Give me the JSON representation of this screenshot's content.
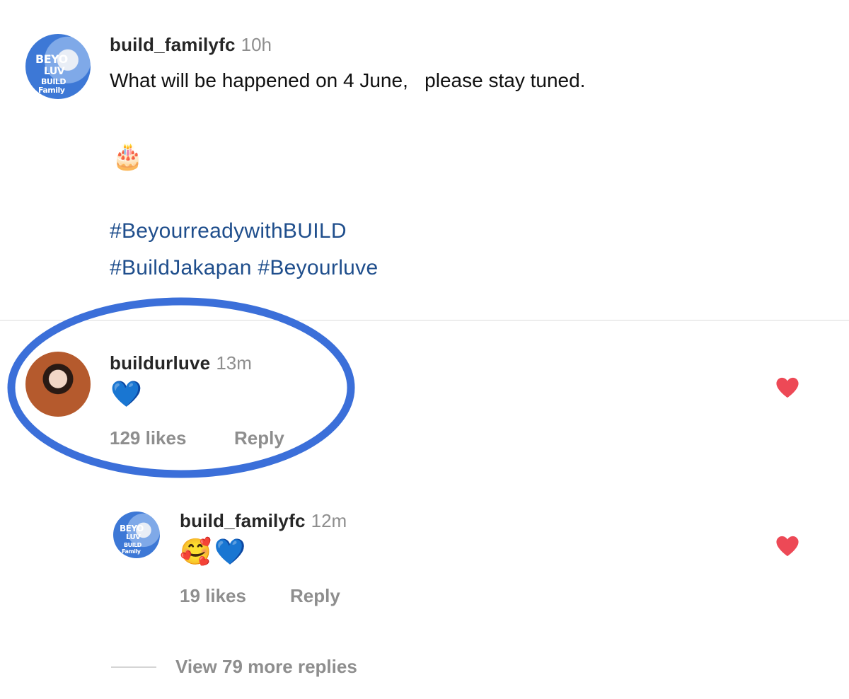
{
  "post": {
    "username": "build_familyfc",
    "time": "10h",
    "text": "What will be happened on 4 June,   please stay tuned.",
    "emoji": "🎂",
    "hashtags_line1": "#BeyourreadywithBUILD",
    "hashtags_line2": "#BuildJakapan #Beyourluve"
  },
  "comment": {
    "username": "buildurluve",
    "time": "13m",
    "text": "💙",
    "likes": "129 likes",
    "reply_label": "Reply",
    "highlight_color": "#3b6fd9"
  },
  "reply": {
    "username": "build_familyfc",
    "time": "12m",
    "text": "🥰💙",
    "likes": "19 likes",
    "reply_label": "Reply"
  },
  "view_more": "View 79 more replies",
  "colors": {
    "heart": "#ed4956",
    "hashtag": "#1f4e8c",
    "muted": "#8e8e8e"
  }
}
